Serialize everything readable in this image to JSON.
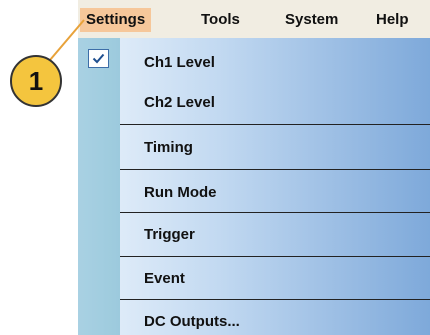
{
  "menubar": {
    "items": [
      {
        "label": "Settings"
      },
      {
        "label": "Tools"
      },
      {
        "label": "System"
      },
      {
        "label": "Help"
      }
    ]
  },
  "dropdown": {
    "items": [
      {
        "label": "Ch1 Level",
        "checked": true
      },
      {
        "label": "Ch2 Level"
      },
      {
        "label": "Timing"
      },
      {
        "label": "Run Mode"
      },
      {
        "label": "Trigger"
      },
      {
        "label": "Event"
      },
      {
        "label": "DC Outputs..."
      }
    ]
  },
  "callout": {
    "number": "1"
  },
  "colors": {
    "active_menu": "#f6c79a",
    "callout_fill": "#f4c53e",
    "check_border": "#3d6ea8"
  }
}
